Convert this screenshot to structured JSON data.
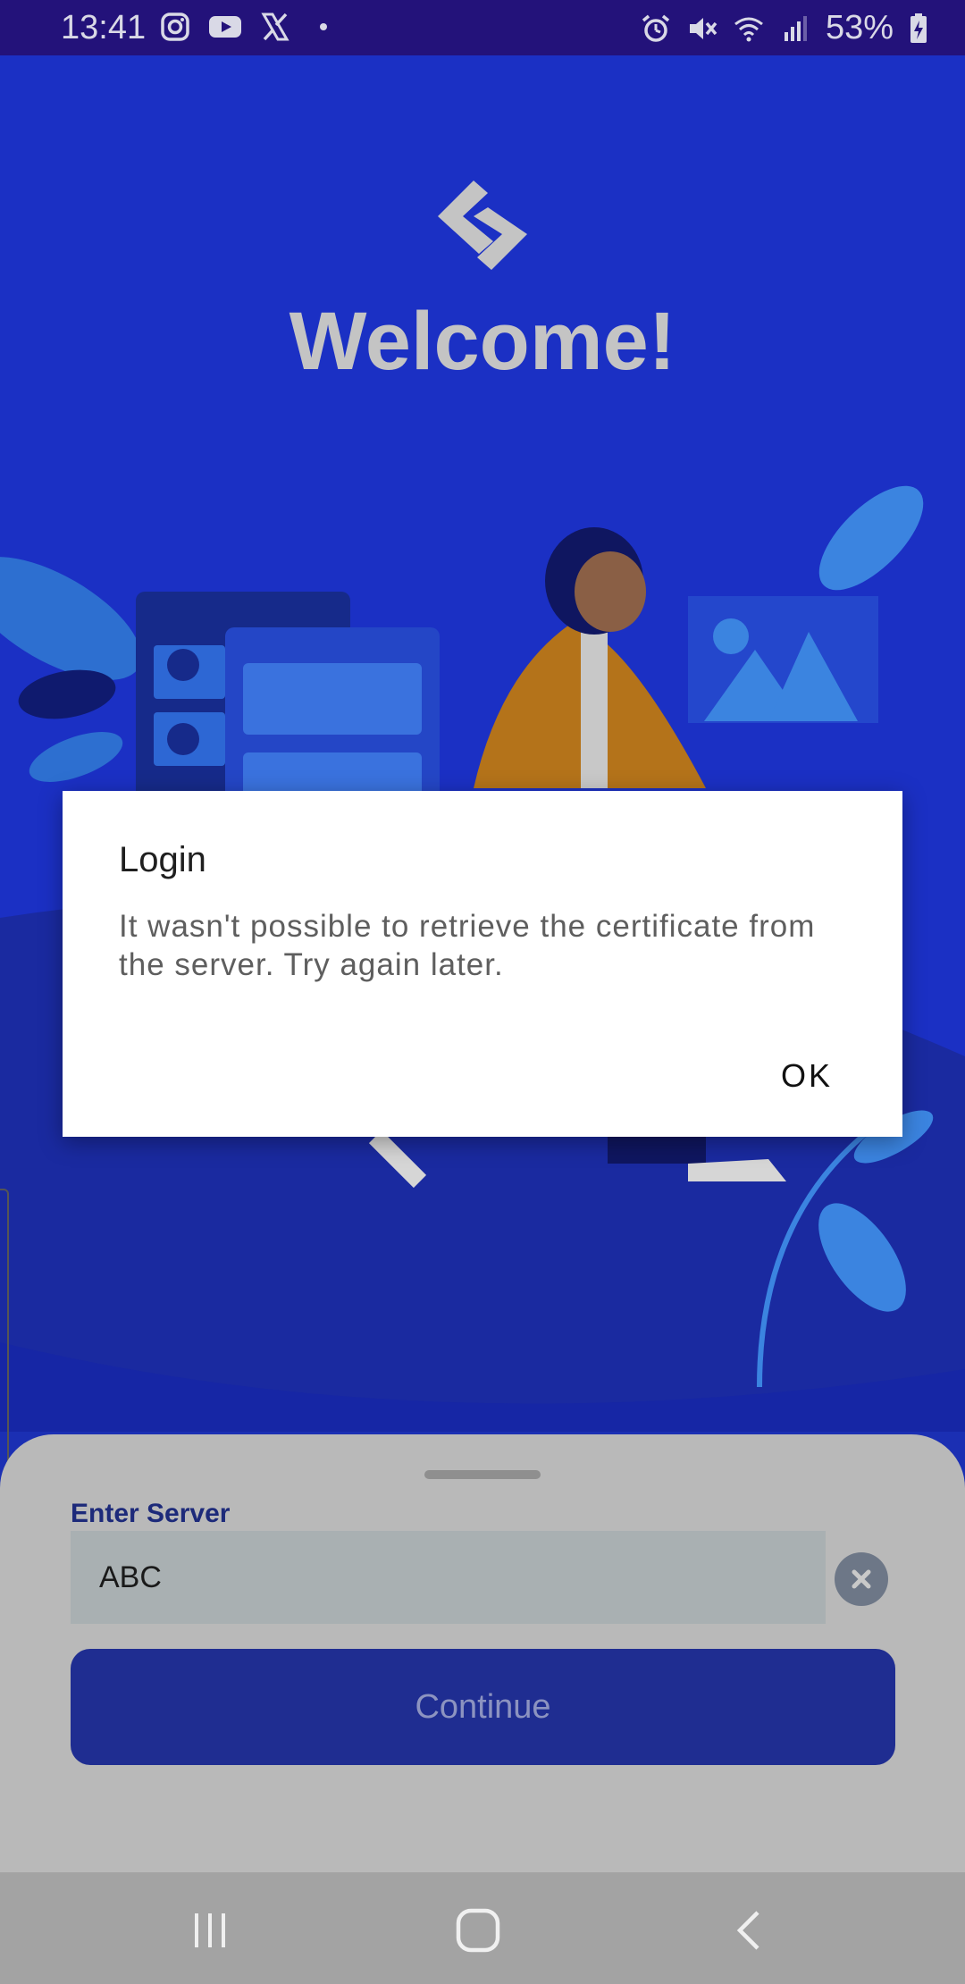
{
  "status_bar": {
    "time": "13:41",
    "battery": "53%",
    "left_icons": [
      "instagram-icon",
      "youtube-icon",
      "x-icon",
      "dot-icon"
    ],
    "right_icons": [
      "alarm-icon",
      "mute-icon",
      "wifi-icon",
      "signal-icon",
      "battery-icon"
    ]
  },
  "header": {
    "welcome": "Welcome!"
  },
  "dialog": {
    "title": "Login",
    "message": "It wasn't possible to retrieve the certificate from the server. Try again later.",
    "ok_label": "OK"
  },
  "sheet": {
    "label": "Enter Server",
    "server_value": "ABC",
    "continue_label": "Continue"
  },
  "colors": {
    "primary": "#1b30c4",
    "status_bar": "#23127a",
    "button": "#1f2d91"
  }
}
